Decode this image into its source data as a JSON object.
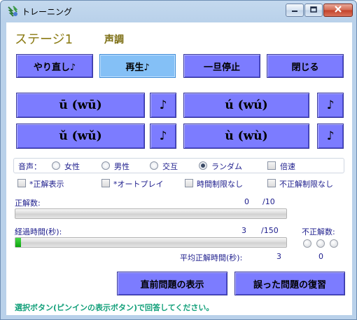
{
  "window": {
    "title": "トレーニング",
    "icons": {
      "app": "tree-app-icon",
      "minimize": "minimize-icon",
      "maximize": "maximize-icon",
      "close": "close-icon"
    }
  },
  "header": {
    "stage": "ステージ1",
    "mode": "声調"
  },
  "toolbar": {
    "redo_label": "やり直し♪",
    "play_label": "再生♪",
    "pause_label": "一旦停止",
    "close_label": "閉じる"
  },
  "answers": [
    {
      "label": "ū (wū)",
      "sound": "♪"
    },
    {
      "label": "ú (wú)",
      "sound": "♪"
    },
    {
      "label": "ǔ (wǔ)",
      "sound": "♪"
    },
    {
      "label": "ù (wù)",
      "sound": "♪"
    }
  ],
  "voice": {
    "label": "音声：",
    "options": [
      "女性",
      "男性",
      "交互",
      "ランダム"
    ],
    "selected": "ランダム",
    "double_speed_label": "倍速",
    "double_speed_checked": false
  },
  "settings": [
    {
      "label": "*正解表示",
      "checked": false
    },
    {
      "label": "*オートプレイ",
      "checked": false
    },
    {
      "label": "時間制限なし",
      "checked": false
    },
    {
      "label": "不正解制限なし",
      "checked": false
    }
  ],
  "stats": {
    "correct_label": "正解数:",
    "correct_value": "0",
    "correct_total": "/10",
    "correct_fraction": 0,
    "elapsed_label": "経過時間(秒):",
    "elapsed_value": "3",
    "elapsed_total": "/150",
    "elapsed_fraction": 0.02,
    "wrong_label": "不正解数:",
    "wrong_value": "0",
    "avg_label": "平均正解時間(秒):",
    "avg_value": "3"
  },
  "actions": {
    "prev_label": "直前問題の表示",
    "review_label": "誤った問題の復習"
  },
  "footer": {
    "instruction": "選択ボタン(ピンインの表示ボタン)で回答してください。"
  },
  "colors": {
    "button": "#7c7cff",
    "button_focus": "#84c0f6",
    "text": "#1c1c8c",
    "stage": "#8a7a12",
    "footer": "#13a07a"
  }
}
